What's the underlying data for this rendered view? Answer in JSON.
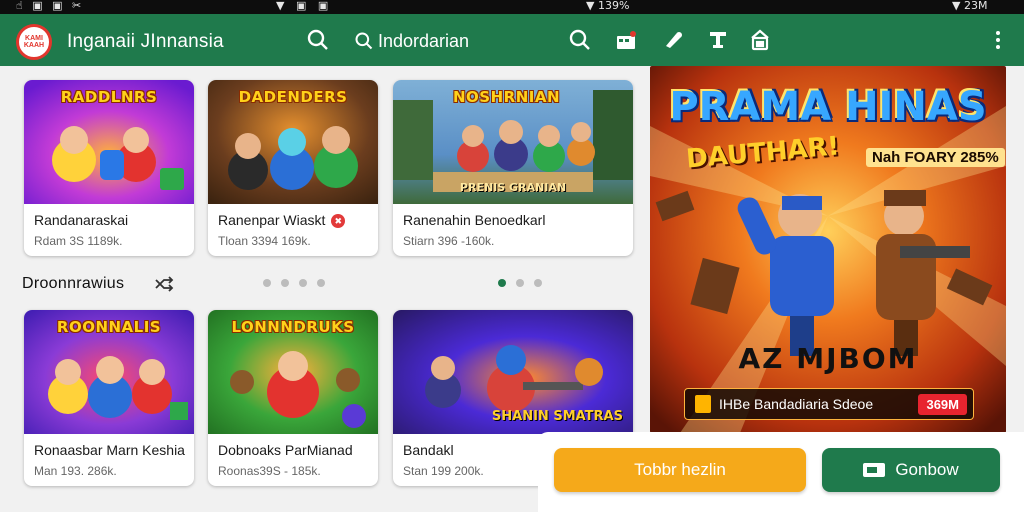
{
  "status_bar": {
    "left_icons": "☝ ▣ ▣ ✂",
    "mid_icons": "▼ ▣ ▣",
    "time_left": "▼ 139%",
    "time_right": "▼ 23M"
  },
  "app_bar": {
    "logo_text": "KAMI KAAH",
    "title": "Inganaii JInnansia",
    "search_placeholder": "Indordarian",
    "icons": [
      "search-icon",
      "search-icon",
      "gift-icon",
      "megaphone-icon",
      "text-icon",
      "store-icon",
      "more-vert-icon"
    ]
  },
  "row1": [
    {
      "thumb_title": "RADDLNRS",
      "thumb_sub": "",
      "title": "Randanaraskai",
      "meta": "Rdam 3S 1189k.",
      "colors": [
        "#c23bd6",
        "#6a1bd0",
        "#ffb03b"
      ]
    },
    {
      "thumb_title": "DADENDERS",
      "thumb_sub": "",
      "title": "Ranenpar Wiaskt",
      "badge": "✖",
      "meta": "Tloan 3394 169k.",
      "colors": [
        "#6b3d1e",
        "#3d2410",
        "#e48f2e"
      ]
    },
    {
      "thumb_title": "NOSHRNIAN",
      "thumb_sub": "PRENIS GRANIAN",
      "title": "Ranenahin Benoedkarl",
      "meta": "Stiarn 396 -160k.",
      "colors": [
        "#5a8fc6",
        "#3f6a3a",
        "#c9a464"
      ]
    }
  ],
  "row2": [
    {
      "thumb_title": "ROONNALIS",
      "thumb_sub": "",
      "title": "Ronaasbar Marn Keshia",
      "meta": "Man 193. 286k.",
      "colors": [
        "#8a3bd6",
        "#3b1bb0",
        "#ff4a6b"
      ]
    },
    {
      "thumb_title": "LONNNDRUKS",
      "thumb_sub": "",
      "title": "Dobnoaks ParMianad",
      "meta": "Roonas39S - 185k.",
      "colors": [
        "#3aa63a",
        "#1f6b1f",
        "#ffb03b"
      ]
    },
    {
      "thumb_title": "",
      "thumb_sub": "SHANIN SMATRAS",
      "title": "Bandakl",
      "meta": "Stan 199 200k.",
      "colors": [
        "#2a1a6b",
        "#4b2ad6",
        "#ff8a2e"
      ]
    }
  ],
  "section": {
    "title": "Droonnrawius",
    "icon": "shuffle-icon"
  },
  "banner": {
    "title": "PRAMA HINAS",
    "subtitle": "DAUTHAR!",
    "tag": "Nah FOARY 285%",
    "big_text": "AZ MJBOM",
    "pill_text": "IHBe Bandadiaria Sdeoe",
    "pill_price": "369M"
  },
  "actions": {
    "primary_label": "Tobbr hezlin",
    "secondary_label": "Gonbow"
  },
  "colors": {
    "app_bar": "#1f7a4c",
    "primary": "#f5a91a",
    "secondary": "#1f7a4c"
  }
}
